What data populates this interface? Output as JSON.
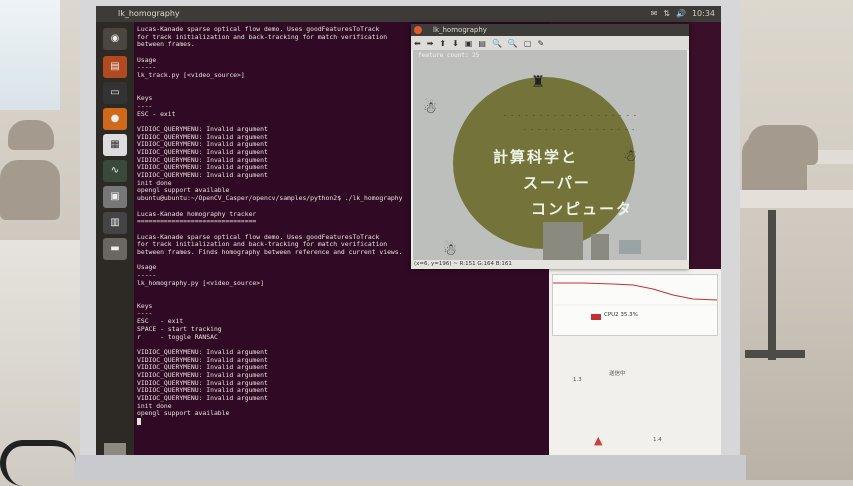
{
  "top_panel": {
    "window_title": "lk_homography",
    "tray": [
      "✉",
      "⇅",
      "🔊",
      "10:34"
    ]
  },
  "launcher": {
    "icons": [
      "ubuntu-icon",
      "files-icon",
      "firefox-icon",
      "text-editor-icon",
      "terminal-icon",
      "system-monitor-icon",
      "libreoffice-icon",
      "workspaces-icon",
      "trash-icon"
    ]
  },
  "terminal": {
    "lines": [
      "Lucas-Kanade sparse optical flow demo. Uses goodFeaturesToTrack",
      "for track initialization and back-tracking for match verification",
      "between frames.",
      "",
      "Usage",
      "-----",
      "lk_track.py [<video_source>]",
      "",
      "",
      "Keys",
      "----",
      "ESC - exit",
      "",
      "VIDIOC_QUERYMENU: Invalid argument",
      "VIDIOC_QUERYMENU: Invalid argument",
      "VIDIOC_QUERYMENU: Invalid argument",
      "VIDIOC_QUERYMENU: Invalid argument",
      "VIDIOC_QUERYMENU: Invalid argument",
      "VIDIOC_QUERYMENU: Invalid argument",
      "VIDIOC_QUERYMENU: Invalid argument",
      "init done",
      "opengl support available",
      "ubuntu@ubuntu:~/OpenCV_Casper/opencv/samples/python2$ ./lk_homography",
      "",
      "Lucas-Kanade homography tracker",
      "===============================",
      "",
      "Lucas-Kanade sparse optical flow demo. Uses goodFeaturesToTrack",
      "for track initialization and back-tracking for match verification",
      "between frames. Finds homography between reference and current views.",
      "",
      "Usage",
      "-----",
      "lk_homography.py [<video_source>]",
      "",
      "",
      "Keys",
      "----",
      "ESC   - exit",
      "SPACE - start tracking",
      "r     - toggle RANSAC",
      "",
      "VIDIOC_QUERYMENU: Invalid argument",
      "VIDIOC_QUERYMENU: Invalid argument",
      "VIDIOC_QUERYMENU: Invalid argument",
      "VIDIOC_QUERYMENU: Invalid argument",
      "VIDIOC_QUERYMENU: Invalid argument",
      "VIDIOC_QUERYMENU: Invalid argument",
      "VIDIOC_QUERYMENU: Invalid argument",
      "init done",
      "opengl support available",
      ""
    ]
  },
  "viewer": {
    "title": "lk_homography",
    "toolbar": [
      "⬅",
      "➡",
      "⬆",
      "⬇",
      "▣",
      "▤",
      "🔍",
      "🔍",
      "▢",
      "✎"
    ],
    "overlay_text": "feature count: 25",
    "status": "(x=6, y=196) ~ R:151 G:164 B:161",
    "poster": {
      "line1": "計算科学と",
      "line2": "スーパー",
      "line3": "コンピュータ"
    }
  },
  "system_monitor": {
    "cpu_legend": "CPU2 35.3%",
    "label_a": "1.3",
    "label_b": "1.4",
    "label_c": "送信中"
  },
  "colors": {
    "terminal_bg": "#300a24",
    "poster_circle": "#74733a",
    "panel": "#3c3b37"
  }
}
